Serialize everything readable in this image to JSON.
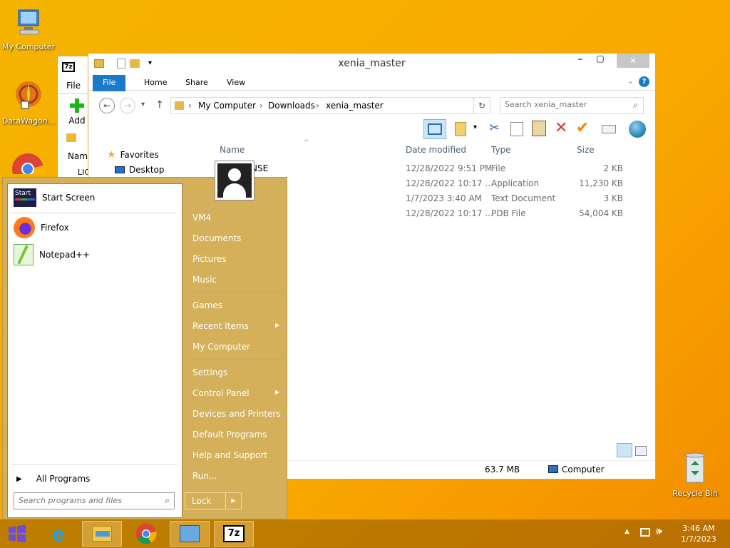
{
  "desktop": {
    "icons": [
      {
        "label": "My Computer",
        "icon": "computer-icon"
      },
      {
        "label": "DataWagon...",
        "icon": "datawagon-icon"
      },
      {
        "label": "Recycle Bin",
        "icon": "recycle-bin-icon"
      }
    ]
  },
  "bg_window": {
    "menu_file": "File",
    "add_label": "Add",
    "col_name": "Name",
    "row_name": "LIC"
  },
  "explorer": {
    "title": "xenia_master",
    "tabs": [
      "File",
      "Home",
      "Share",
      "View"
    ],
    "breadcrumb": [
      "My Computer",
      "Downloads",
      "xenia_master"
    ],
    "search_placeholder": "Search xenia_master",
    "nav": {
      "favorites": "Favorites",
      "desktop": "Desktop"
    },
    "columns": {
      "name": "Name",
      "date": "Date modified",
      "type": "Type",
      "size": "Size"
    },
    "rows": [
      {
        "name": "LICENSE",
        "date": "12/28/2022 9:51 PM",
        "type": "File",
        "size": "2 KB"
      },
      {
        "name": "",
        "date": "12/28/2022 10:17 ...",
        "type": "Application",
        "size": "11,230 KB"
      },
      {
        "name": "",
        "date": "1/7/2023 3:40 AM",
        "type": "Text Document",
        "size": "3 KB"
      },
      {
        "name": "",
        "date": "12/28/2022 10:17 ...",
        "type": "PDB File",
        "size": "54,004 KB"
      }
    ],
    "visible_name_fragment": "NSE",
    "status_size": "63.7 MB",
    "status_location": "Computer"
  },
  "start_menu": {
    "left_items": [
      {
        "label": "Start Screen",
        "icon": "start-screen-icon"
      },
      {
        "label": "Firefox",
        "icon": "firefox-icon"
      },
      {
        "label": "Notepad++",
        "icon": "notepadpp-icon"
      }
    ],
    "all_programs": "All Programs",
    "search_placeholder": "Search programs and files",
    "start_tile_text": "Start",
    "right_items": [
      "VM4",
      "Documents",
      "Pictures",
      "Music",
      "Games",
      "Recent Items",
      "My Computer",
      "Settings",
      "Control Panel",
      "Devices and Printers",
      "Default Programs",
      "Help and Support",
      "Run..."
    ],
    "lock_label": "Lock"
  },
  "taskbar": {
    "apps": [
      "start-button",
      "internet-explorer-icon",
      "file-explorer-icon",
      "chrome-icon",
      "control-panel-icon",
      "7zip-icon"
    ],
    "sevenzip_label": "7z",
    "time": "3:46 AM",
    "date": "1/7/2023"
  }
}
